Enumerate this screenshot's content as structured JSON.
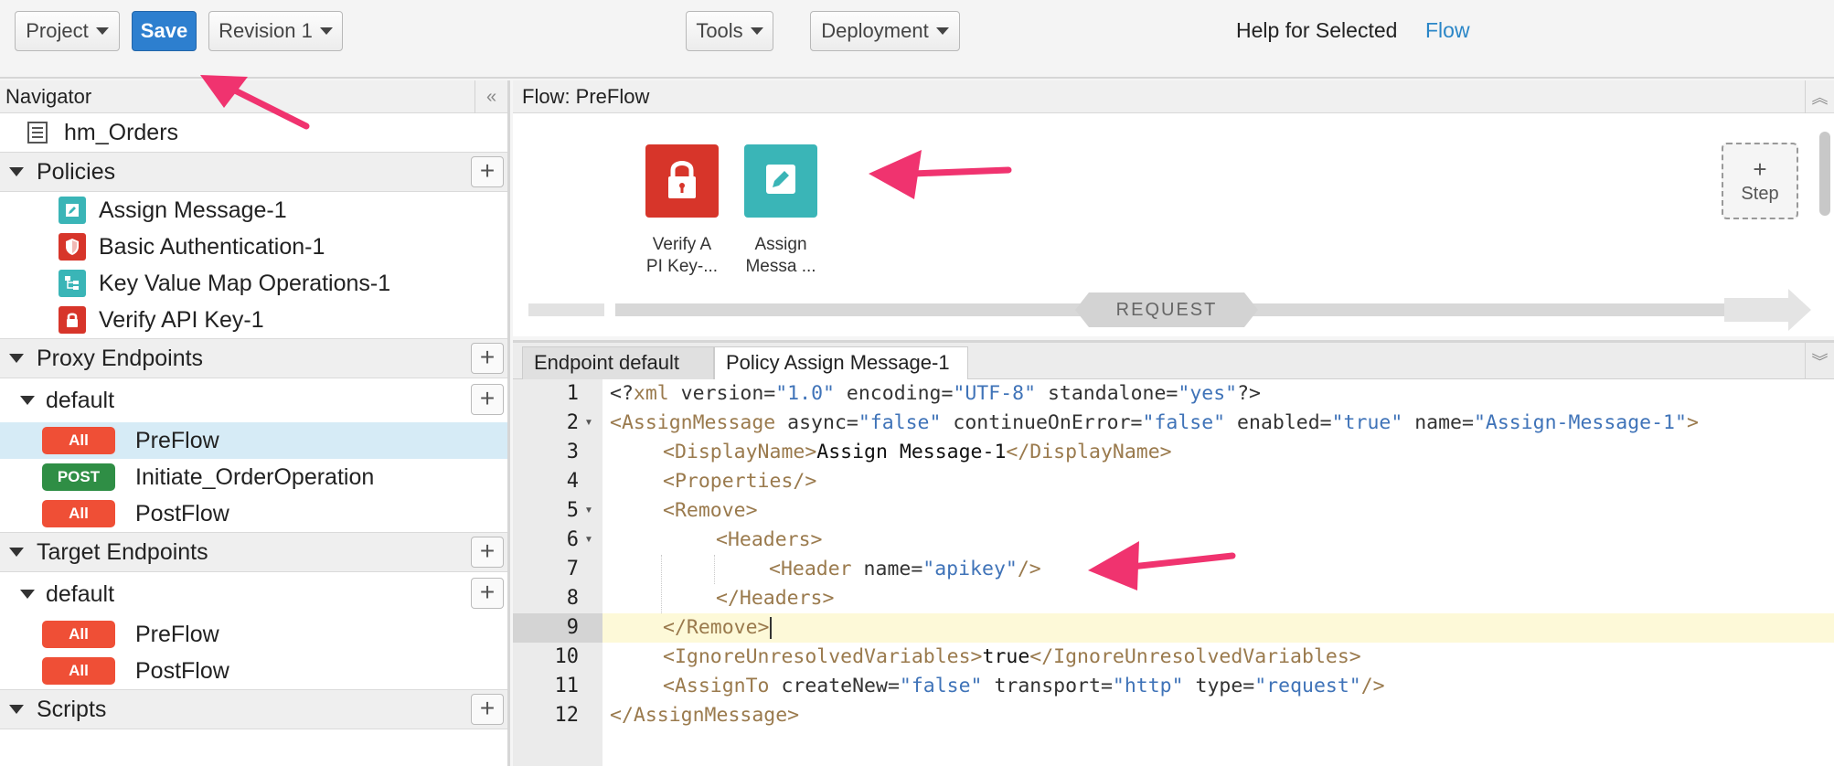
{
  "toolbar": {
    "project_label": "Project",
    "save_label": "Save",
    "revision_label": "Revision 1",
    "tools_label": "Tools",
    "deployment_label": "Deployment",
    "help_label": "Help for Selected",
    "help_link": "Flow"
  },
  "navigator": {
    "title": "Navigator",
    "proxy_name": "hm_Orders",
    "policies_title": "Policies",
    "policies": [
      {
        "label": "Assign Message-1",
        "icon": "pencil-icon",
        "color": "#3ab5b7"
      },
      {
        "label": "Basic Authentication-1",
        "icon": "shield-icon",
        "color": "#d7352a"
      },
      {
        "label": "Key Value Map Operations-1",
        "icon": "kvm-icon",
        "color": "#3ab5b7"
      },
      {
        "label": "Verify API Key-1",
        "icon": "lock-icon",
        "color": "#d7352a"
      }
    ],
    "proxy_endpoints_title": "Proxy Endpoints",
    "proxy_default": "default",
    "proxy_flows": [
      {
        "badge": "All",
        "label": "PreFlow"
      },
      {
        "badge": "POST",
        "label": "Initiate_OrderOperation"
      },
      {
        "badge": "All",
        "label": "PostFlow"
      }
    ],
    "target_endpoints_title": "Target Endpoints",
    "target_default": "default",
    "target_flows": [
      {
        "badge": "All",
        "label": "PreFlow"
      },
      {
        "badge": "All",
        "label": "PostFlow"
      }
    ],
    "scripts_title": "Scripts"
  },
  "flow": {
    "title": "Flow: PreFlow",
    "steps": [
      {
        "label_line1": "Verify A",
        "label_line2": "PI Key-...",
        "icon": "lock-icon",
        "color": "#d7352a"
      },
      {
        "label_line1": "Assign",
        "label_line2": "Messa ...",
        "icon": "pencil-icon",
        "color": "#3ab5b7"
      }
    ],
    "add_step_plus": "+",
    "add_step_label": "Step",
    "request_label": "REQUEST"
  },
  "editor": {
    "tabs": [
      "Endpoint default",
      "Policy Assign Message-1"
    ],
    "line_numbers": [
      "1",
      "2",
      "3",
      "4",
      "5",
      "6",
      "7",
      "8",
      "9",
      "10",
      "11",
      "12"
    ],
    "code": {
      "l1": {
        "p1": "<?",
        "p2": "xml",
        "p3": " version=",
        "p4": "\"1.0\"",
        "p5": " encoding=",
        "p6": "\"UTF-8\"",
        "p7": " standalone=",
        "p8": "\"yes\"",
        "p9": "?>"
      },
      "l2": {
        "p1": "<AssignMessage",
        "p2": " async=",
        "p3": "\"false\"",
        "p4": " continueOnError=",
        "p5": "\"false\"",
        "p6": " enabled=",
        "p7": "\"true\"",
        "p8": " name=",
        "p9": "\"Assign-Message-1\"",
        "p10": ">"
      },
      "l3": {
        "p1": "<DisplayName>",
        "p2": "Assign Message-1",
        "p3": "</DisplayName>"
      },
      "l4": {
        "p1": "<Properties/>"
      },
      "l5": {
        "p1": "<Remove>"
      },
      "l6": {
        "p1": "<Headers>"
      },
      "l7": {
        "p1": "<Header",
        "p2": " name=",
        "p3": "\"apikey\"",
        "p4": "/>"
      },
      "l8": {
        "p1": "</Headers>"
      },
      "l9": {
        "p1": "</Remove>"
      },
      "l10": {
        "p1": "<IgnoreUnresolvedVariables>",
        "p2": "true",
        "p3": "</IgnoreUnresolvedVariables>"
      },
      "l11": {
        "p1": "<AssignTo",
        "p2": " createNew=",
        "p3": "\"false\"",
        "p4": " transport=",
        "p5": "\"http\"",
        "p6": " type=",
        "p7": "\"request\"",
        "p8": "/>"
      },
      "l12": {
        "p1": "</AssignMessage>"
      }
    }
  },
  "colors": {
    "accent": "#2d7fcf",
    "annotation_arrow": "#f0336f",
    "badge_all": "#ef4f36",
    "badge_post": "#2f8e45"
  }
}
